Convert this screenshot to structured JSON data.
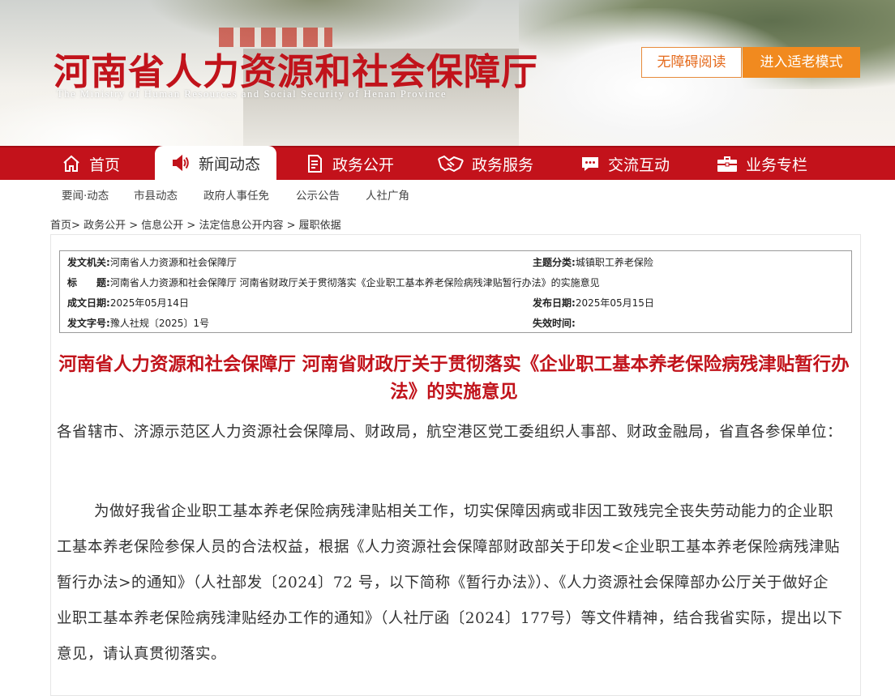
{
  "header": {
    "title": "河南省人力资源和社会保障厅",
    "subtitle": "The Ministry of Human Resources and Social Security of Henan Province",
    "accessibility_button": "无障碍阅读",
    "elder_mode_button": "进入适老模式",
    "accent_color": "#c1131b",
    "button_color": "#f18a1f"
  },
  "nav": {
    "items": [
      {
        "label": "首页",
        "icon": "home-icon"
      },
      {
        "label": "新闻动态",
        "icon": "speaker-icon",
        "active": true
      },
      {
        "label": "政务公开",
        "icon": "document-icon"
      },
      {
        "label": "政务服务",
        "icon": "handshake-icon"
      },
      {
        "label": "交流互动",
        "icon": "chat-icon"
      },
      {
        "label": "业务专栏",
        "icon": "briefcase-icon"
      }
    ]
  },
  "subnav": {
    "items": [
      "要闻·动态",
      "市县动态",
      "政府人事任免",
      "公示公告",
      "人社广角"
    ]
  },
  "breadcrumb": {
    "items": [
      "首页",
      "政务公开",
      "信息公开",
      "法定信息公开内容",
      "履职依据"
    ],
    "separator": ">"
  },
  "meta": {
    "issuer_label": "发文机关:",
    "issuer": "河南省人力资源和社会保障厅",
    "topic_label": "主题分类:",
    "topic": "城镇职工养老保险",
    "title_label": "标　　题:",
    "title": "河南省人力资源和社会保障厅 河南省财政厅关于贯彻落实《企业职工基本养老保险病残津贴暂行办法》的实施意见",
    "created_label": "成文日期:",
    "created": "2025年05月14日",
    "published_label": "发布日期:",
    "published": "2025年05月15日",
    "doc_no_label": "发文字号:",
    "doc_no": "豫人社规〔2025〕1号",
    "expiry_label": "失效时间:",
    "expiry": ""
  },
  "article": {
    "title": "河南省人力资源和社会保障厅 河南省财政厅关于贯彻落实《企业职工基本养老保险病残津贴暂行办法》的实施意见",
    "salutation": "各省辖市、济源示范区人力资源社会保障局、财政局，航空港区党工委组织人事部、财政金融局，省直各参保单位：",
    "paragraph1": "为做好我省企业职工基本养老保险病残津贴相关工作，切实保障因病或非因工致残完全丧失劳动能力的企业职工基本养老保险参保人员的合法权益，根据《人力资源社会保障部财政部关于印发<企业职工基本养老保险病残津贴暂行办法>的通知》（人社部发〔2024〕72 号，以下简称《暂行办法》）、《人力资源社会保障部办公厅关于做好企业职工基本养老保险病残津贴经办工作的通知》（人社厅函〔2024〕177号）等文件精神，结合我省实际，提出以下意见，请认真贯彻落实。"
  }
}
